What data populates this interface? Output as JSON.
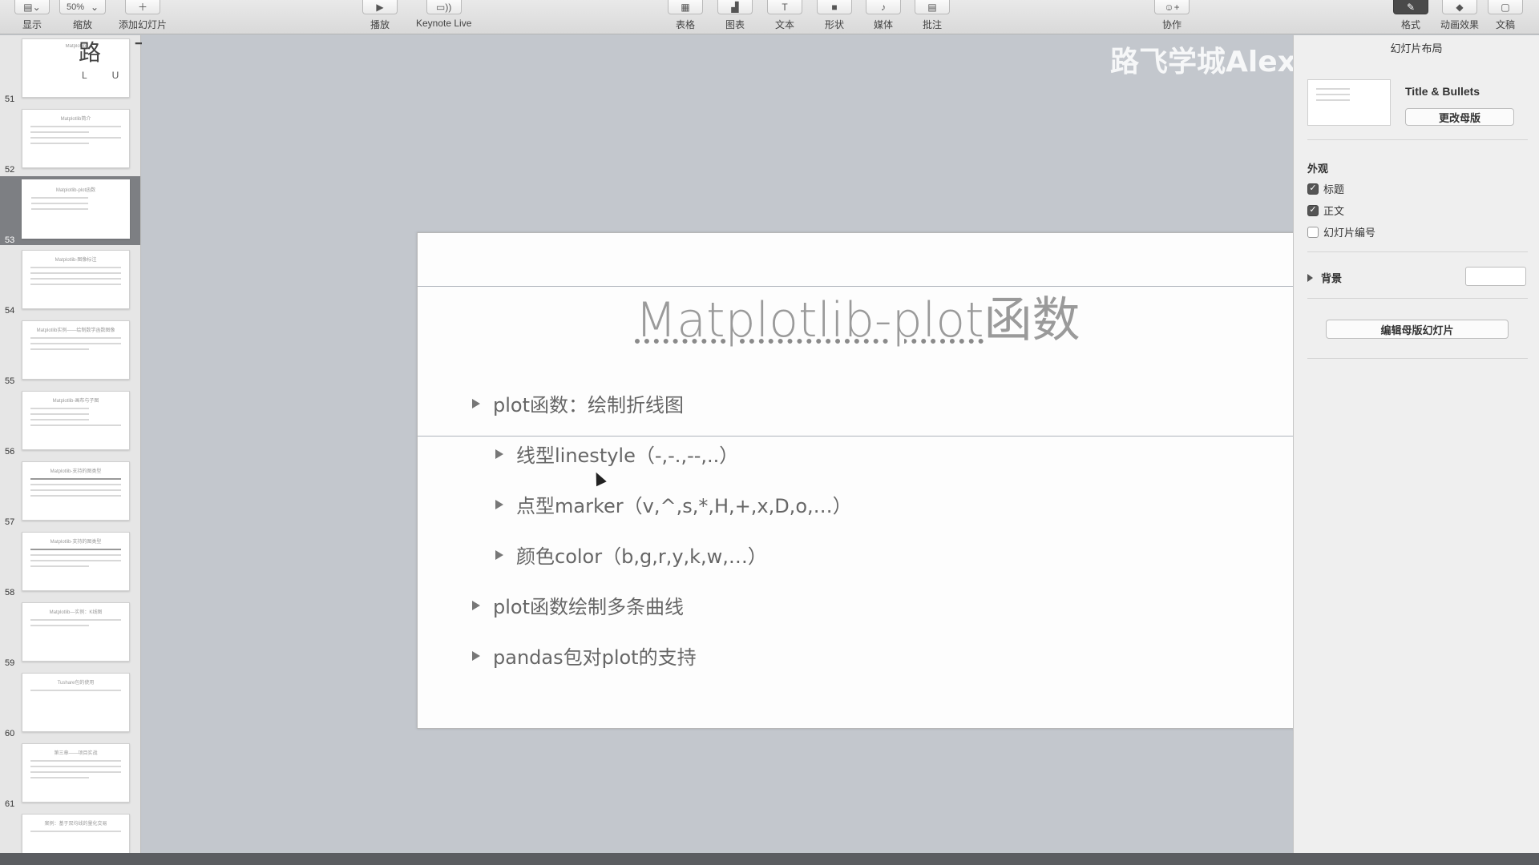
{
  "toolbar": {
    "view_label": "显示",
    "zoom_value": "50%",
    "zoom_label": "缩放",
    "add_slide_label": "添加幻灯片",
    "play_label": "播放",
    "keynote_live_label": "Keynote Live",
    "table_label": "表格",
    "chart_label": "图表",
    "text_label": "文本",
    "shape_label": "形状",
    "media_label": "媒体",
    "comment_label": "批注",
    "collaborate_label": "协作",
    "format_label": "格式",
    "animate_label": "动画效果",
    "document_label": "文稿"
  },
  "logo": {
    "cn": "路 飞 学 城",
    "en": "L U F F Y C I T Y"
  },
  "navigator": {
    "slides": [
      {
        "num": "51",
        "title": "Matplotlib"
      },
      {
        "num": "52",
        "title": "Matplotlib简介"
      },
      {
        "num": "53",
        "title": "Matplotlib-plot函数",
        "selected": true
      },
      {
        "num": "54",
        "title": "Matplotlib-图像标注"
      },
      {
        "num": "55",
        "title": "Matplotlib实例——绘制数学函数图像"
      },
      {
        "num": "56",
        "title": "Matplotlib-画布与子图"
      },
      {
        "num": "57",
        "title": "Matplotlib-支持的图类型"
      },
      {
        "num": "58",
        "title": "Matplotlib-支持的图类型"
      },
      {
        "num": "59",
        "title": "Matplotlib—实例：K线图"
      },
      {
        "num": "60",
        "title": "Tushare包的使用"
      },
      {
        "num": "61",
        "title": "第三章——项目实战"
      },
      {
        "num": "",
        "title": "案例：基于双均线的量化交易"
      }
    ]
  },
  "slide": {
    "title_underlined": "Matplotlib-plot",
    "title_rest": "函数",
    "bullets": [
      {
        "text": "plot函数：绘制折线图",
        "level": 1
      },
      {
        "text": "线型linestyle（-,-.,--,..）",
        "level": 2
      },
      {
        "text": "点型marker（v,^,s,*,H,+,x,D,o,…）",
        "level": 2
      },
      {
        "text": "颜色color（b,g,r,y,k,w,…）",
        "level": 2
      },
      {
        "text": "plot函数绘制多条曲线",
        "level": 1
      },
      {
        "text": "pandas包对plot的支持",
        "level": 1
      }
    ]
  },
  "watermark": {
    "text": "路飞学城Alex讲Python"
  },
  "inspector": {
    "tab_title": "幻灯片布局",
    "layout_name": "Title & Bullets",
    "change_master_label": "更改母版",
    "appearance_label": "外观",
    "options": [
      {
        "label": "标题",
        "checked": true
      },
      {
        "label": "正文",
        "checked": true
      },
      {
        "label": "幻灯片编号",
        "checked": false
      }
    ],
    "background_label": "背景",
    "edit_master_label": "编辑母版幻灯片"
  }
}
